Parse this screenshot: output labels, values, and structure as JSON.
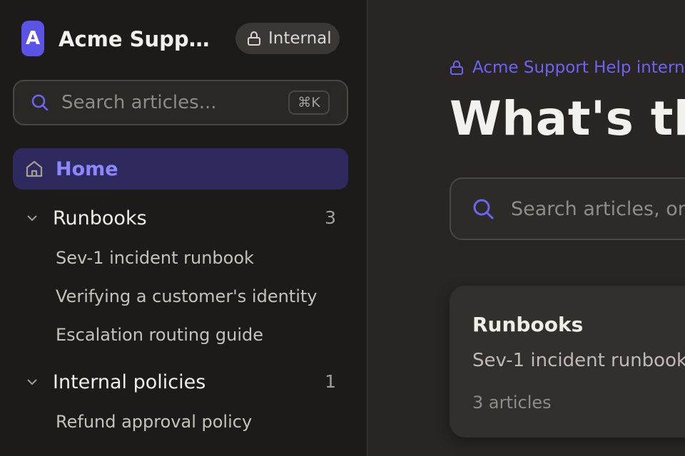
{
  "brand": {
    "logo_letter": "A",
    "name": "Acme Support ...",
    "badge": "Internal"
  },
  "sidebar": {
    "search_placeholder": "Search articles...",
    "search_shortcut": "⌘K",
    "home_label": "Home",
    "groups": [
      {
        "label": "Runbooks",
        "count": "3",
        "items": [
          "Sev-1 incident runbook",
          "Verifying a customer's identity",
          "Escalation routing guide"
        ]
      },
      {
        "label": "Internal policies",
        "count": "1",
        "items": [
          "Refund approval policy"
        ]
      }
    ]
  },
  "main": {
    "help_link": "Acme Support Help internal",
    "title": "What's the",
    "search_placeholder": "Search articles, or d",
    "card": {
      "title": "Runbooks",
      "subtitle": "Sev-1 incident runbook",
      "meta": "3 articles"
    }
  },
  "colors": {
    "accent": "#5b52e6",
    "accent_text": "#6d63f5",
    "sidebar_bg": "#1c1b19",
    "main_bg": "#282523",
    "active_bg": "#2f2a5e"
  },
  "icons": [
    "lock-icon",
    "search-icon",
    "home-icon",
    "chevron-down-icon"
  ]
}
